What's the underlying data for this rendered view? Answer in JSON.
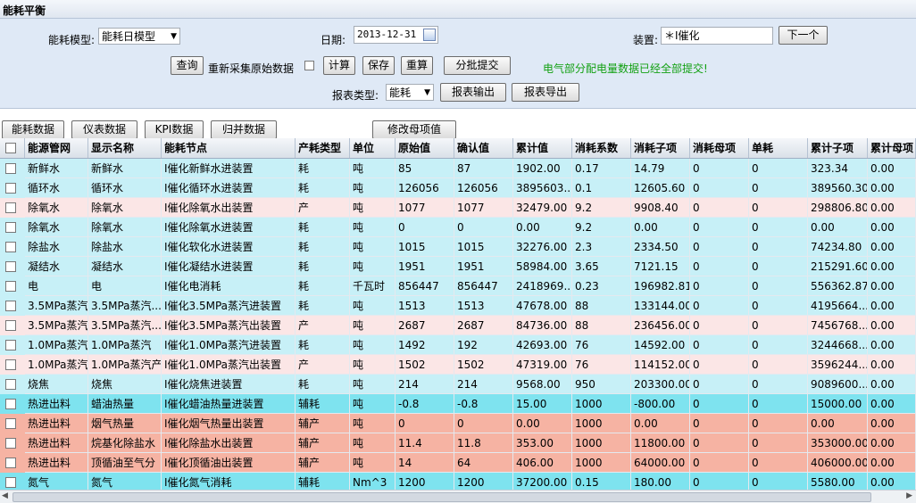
{
  "window": {
    "title": "能耗平衡"
  },
  "form": {
    "model_label": "能耗模型:",
    "model_value": "能耗日模型",
    "date_label": "日期:",
    "date_value": "2013-12-31",
    "device_label": "装置:",
    "device_value": "＊Ⅰ催化",
    "next_button": "下一个",
    "query_button": "查询",
    "recollect_label": "重新采集原始数据",
    "calc_button": "计算",
    "save_button": "保存",
    "recalc_button": "重算",
    "batch_submit_button": "分批提交",
    "status_note": "电气部分配电量数据已经全部提交!",
    "report_type_label": "报表类型:",
    "report_type_value": "能耗",
    "report_output_button": "报表输出",
    "report_export_button": "报表导出"
  },
  "tabs": {
    "energy_data": "能耗数据",
    "meter_data": "仪表数据",
    "kpi_data": "KPI数据",
    "merge_data": "归并数据",
    "edit_parent": "修改母项值"
  },
  "columns": [
    "能源管网",
    "显示名称",
    "能耗节点",
    "产耗类型",
    "单位",
    "原始值",
    "确认值",
    "累计值",
    "消耗系数",
    "消耗子项",
    "消耗母项",
    "单耗",
    "累计子项",
    "累计母项"
  ],
  "colors": {
    "cyan": "#c7f0f7",
    "pink": "#fbe6e6",
    "teal": "#7ee3ef",
    "salmon": "#f6b3a3"
  },
  "rows": [
    {
      "color": "cyan",
      "cells": [
        "新鲜水",
        "新鲜水",
        "Ⅰ催化新鲜水进装置",
        "耗",
        "吨",
        "85",
        "87",
        "1902.00",
        "0.17",
        "14.79",
        "0",
        "0",
        "323.34",
        "0.00"
      ]
    },
    {
      "color": "cyan",
      "cells": [
        "循环水",
        "循环水",
        "Ⅰ催化循环水进装置",
        "耗",
        "吨",
        "126056",
        "126056",
        "3895603....",
        "0.1",
        "12605.60",
        "0",
        "0",
        "389560.30",
        "0.00"
      ]
    },
    {
      "color": "pink",
      "cells": [
        "除氧水",
        "除氧水",
        "Ⅰ催化除氧水出装置",
        "产",
        "吨",
        "1077",
        "1077",
        "32479.00",
        "9.2",
        "9908.40",
        "0",
        "0",
        "298806.80",
        "0.00"
      ]
    },
    {
      "color": "cyan",
      "cells": [
        "除氧水",
        "除氧水",
        "Ⅰ催化除氧水进装置",
        "耗",
        "吨",
        "0",
        "0",
        "0.00",
        "9.2",
        "0.00",
        "0",
        "0",
        "0.00",
        "0.00"
      ]
    },
    {
      "color": "cyan",
      "cells": [
        "除盐水",
        "除盐水",
        "Ⅰ催化软化水进装置",
        "耗",
        "吨",
        "1015",
        "1015",
        "32276.00",
        "2.3",
        "2334.50",
        "0",
        "0",
        "74234.80",
        "0.00"
      ]
    },
    {
      "color": "cyan",
      "cells": [
        "凝结水",
        "凝结水",
        "Ⅰ催化凝结水进装置",
        "耗",
        "吨",
        "1951",
        "1951",
        "58984.00",
        "3.65",
        "7121.15",
        "0",
        "0",
        "215291.60",
        "0.00"
      ]
    },
    {
      "color": "cyan",
      "cells": [
        "电",
        "电",
        "Ⅰ催化电消耗",
        "耗",
        "千瓦时",
        "856447",
        "856447",
        "2418969....",
        "0.23",
        "196982.81",
        "0",
        "0",
        "556362.87",
        "0.00"
      ]
    },
    {
      "color": "cyan",
      "cells": [
        "3.5MPa蒸汽",
        "3.5MPa蒸汽...",
        "Ⅰ催化3.5MPa蒸汽进装置",
        "耗",
        "吨",
        "1513",
        "1513",
        "47678.00",
        "88",
        "133144.00",
        "0",
        "0",
        "4195664....",
        "0.00"
      ]
    },
    {
      "color": "pink",
      "cells": [
        "3.5MPa蒸汽",
        "3.5MPa蒸汽...",
        "Ⅰ催化3.5MPa蒸汽出装置",
        "产",
        "吨",
        "2687",
        "2687",
        "84736.00",
        "88",
        "236456.00",
        "0",
        "0",
        "7456768....",
        "0.00"
      ]
    },
    {
      "color": "cyan",
      "cells": [
        "1.0MPa蒸汽",
        "1.0MPa蒸汽",
        "Ⅰ催化1.0MPa蒸汽进装置",
        "耗",
        "吨",
        "1492",
        "192",
        "42693.00",
        "76",
        "14592.00",
        "0",
        "0",
        "3244668....",
        "0.00"
      ]
    },
    {
      "color": "pink",
      "cells": [
        "1.0MPa蒸汽",
        "1.0MPa蒸汽产",
        "Ⅰ催化1.0MPa蒸汽出装置",
        "产",
        "吨",
        "1502",
        "1502",
        "47319.00",
        "76",
        "114152.00",
        "0",
        "0",
        "3596244....",
        "0.00"
      ]
    },
    {
      "color": "cyan",
      "cells": [
        "烧焦",
        "烧焦",
        "Ⅰ催化烧焦进装置",
        "耗",
        "吨",
        "214",
        "214",
        "9568.00",
        "950",
        "203300.00",
        "0",
        "0",
        "9089600....",
        "0.00"
      ]
    },
    {
      "color": "teal",
      "cells": [
        "热进出料",
        "蜡油热量",
        "Ⅰ催化蜡油热量进装置",
        "辅耗",
        "吨",
        "-0.8",
        "-0.8",
        "15.00",
        "1000",
        "-800.00",
        "0",
        "0",
        "15000.00",
        "0.00"
      ]
    },
    {
      "color": "salmon",
      "cells": [
        "热进出料",
        "烟气热量",
        "Ⅰ催化烟气热量出装置",
        "辅产",
        "吨",
        "0",
        "0",
        "0.00",
        "1000",
        "0.00",
        "0",
        "0",
        "0.00",
        "0.00"
      ]
    },
    {
      "color": "salmon",
      "cells": [
        "热进出料",
        "烷基化除盐水",
        "Ⅰ催化除盐水出装置",
        "辅产",
        "吨",
        "11.4",
        "11.8",
        "353.00",
        "1000",
        "11800.00",
        "0",
        "0",
        "353000.00",
        "0.00"
      ]
    },
    {
      "color": "salmon",
      "cells": [
        "热进出料",
        "顶循油至气分",
        "Ⅰ催化顶循油出装置",
        "辅产",
        "吨",
        "14",
        "64",
        "406.00",
        "1000",
        "64000.00",
        "0",
        "0",
        "406000.00",
        "0.00"
      ]
    },
    {
      "color": "teal",
      "cells": [
        "氮气",
        "氮气",
        "Ⅰ催化氮气消耗",
        "辅耗",
        "Nm^3",
        "1200",
        "1200",
        "37200.00",
        "0.15",
        "180.00",
        "0",
        "0",
        "5580.00",
        "0.00"
      ]
    }
  ]
}
